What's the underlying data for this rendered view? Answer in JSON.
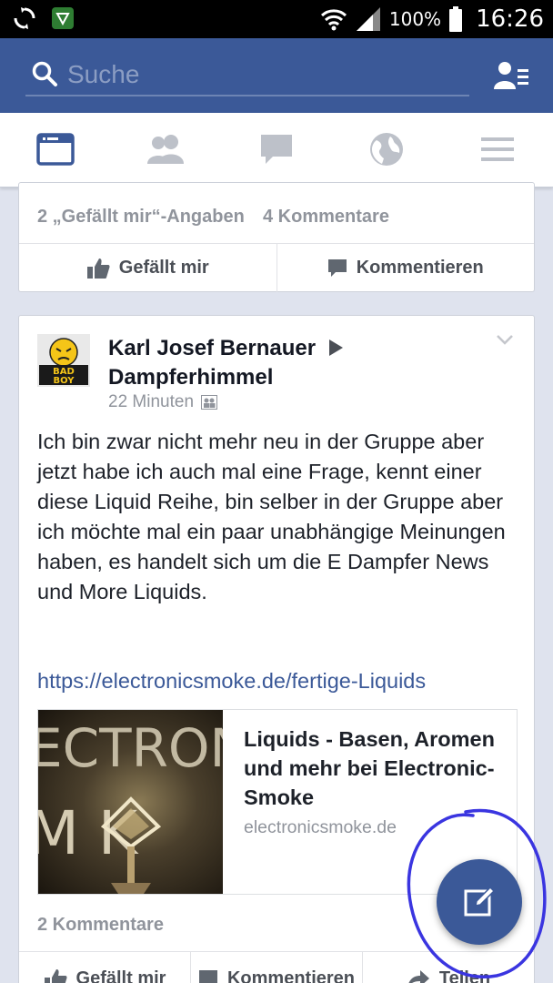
{
  "status_bar": {
    "battery_percent": "100%",
    "time": "16:26",
    "icons": [
      "sync-icon",
      "vpn-shield-icon",
      "wifi-icon",
      "signal-icon",
      "battery-icon"
    ]
  },
  "search": {
    "placeholder": "Suche",
    "value": ""
  },
  "nav_tabs": [
    "news-feed-icon",
    "friends-icon",
    "messages-icon",
    "notifications-globe-icon",
    "menu-icon"
  ],
  "previous_post": {
    "likes": "2 „Gefällt mir“-Angaben",
    "comments": "4 Kommentare",
    "actions": {
      "like": "Gefällt mir",
      "comment": "Kommentieren"
    }
  },
  "post": {
    "author": "Karl Josef Bernauer",
    "group": "Dampferhimmel",
    "time": "22 Minuten",
    "avatar_text": "BAD BOY",
    "text": "Ich bin zwar nicht mehr neu in der Gruppe aber jetzt habe ich auch mal eine Frage, kennt einer diese Liquid Reihe, bin selber in der Gruppe aber ich möchte mal ein paar unabhängige Meinungen haben, es handelt sich um die E Dampfer News und More Liquids.",
    "link": "https://electronicsmoke.de/fertige-Liquids",
    "preview": {
      "image_text_top": "ECTRON",
      "image_text_bottom": "M   K",
      "title": "Liquids - Basen, Aromen und mehr bei Electronic-Smoke",
      "domain": "electronicsmoke.de"
    },
    "comments": "2 Kommentare",
    "actions": {
      "like": "Gefällt mir",
      "comment": "Kommentieren",
      "share": "Teilen"
    }
  },
  "colors": {
    "brand": "#3b5998",
    "annotation": "#3a35e0"
  }
}
